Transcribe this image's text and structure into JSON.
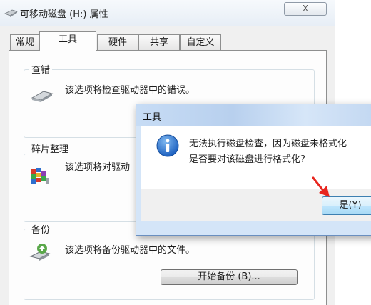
{
  "window": {
    "title": "可移动磁盘 (H:) 属性",
    "close_label": "X"
  },
  "tabs": [
    {
      "label": "常规"
    },
    {
      "label": "工具"
    },
    {
      "label": "硬件"
    },
    {
      "label": "共享"
    },
    {
      "label": "自定义"
    }
  ],
  "active_tab": "工具",
  "groups": {
    "check": {
      "label": "查错",
      "description": "该选项将检查驱动器中的错误。"
    },
    "defrag": {
      "label": "碎片整理",
      "description": "该选项将对驱动"
    },
    "backup": {
      "label": "备份",
      "description": "该选项将备份驱动器中的文件。",
      "button_label": "开始备份 (B)..."
    }
  },
  "dialog": {
    "title": "工具",
    "message_line1": "无法执行磁盘检查，因为磁盘未格式化",
    "message_line2": "是否要对该磁盘进行格式化?",
    "yes_label": "是(Y)",
    "icon": "info-icon"
  },
  "colors": {
    "dialog_accent": "#6a8fc0",
    "info_icon": "#1b6fd1",
    "arrow": "#e8261f"
  }
}
